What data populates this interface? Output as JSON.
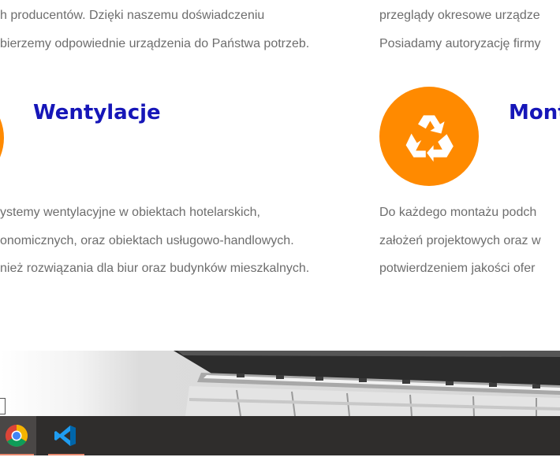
{
  "colors": {
    "accent_orange": "#ff8a00",
    "heading_blue": "#1616b8",
    "body_text": "#6d6d6d",
    "taskbar_bg": "#2f2d2c",
    "taskbar_active_bg": "#4a4746",
    "taskbar_underline": "#e8896e"
  },
  "top": {
    "left_lines": [
      "h producentów. Dzięki naszemu doświadczeniu",
      "bierzemy odpowiednie urządzenia do Państwa potrzeb."
    ],
    "right_lines": [
      "przeglądy okresowe urządze",
      "Posiadamy autoryzację firmy"
    ]
  },
  "wentylacje": {
    "title": "Wentylacje",
    "lines": [
      "ystemy wentylacyjne w obiektach hotelarskich,",
      "onomicznych, oraz obiektach usługowo-handlowych.",
      "nież rozwiązania dla biur oraz budynków mieszkalnych."
    ]
  },
  "montaz": {
    "title": "Mont",
    "icon": "recycle-icon",
    "lines": [
      "Do każdego montażu podch",
      "założeń projektowych oraz w",
      "potwierdzeniem jakości ofer"
    ]
  },
  "taskbar": {
    "apps": [
      {
        "name": "chrome",
        "icon": "chrome-icon",
        "active": true
      },
      {
        "name": "vscode",
        "icon": "vscode-icon",
        "active": false
      }
    ]
  }
}
